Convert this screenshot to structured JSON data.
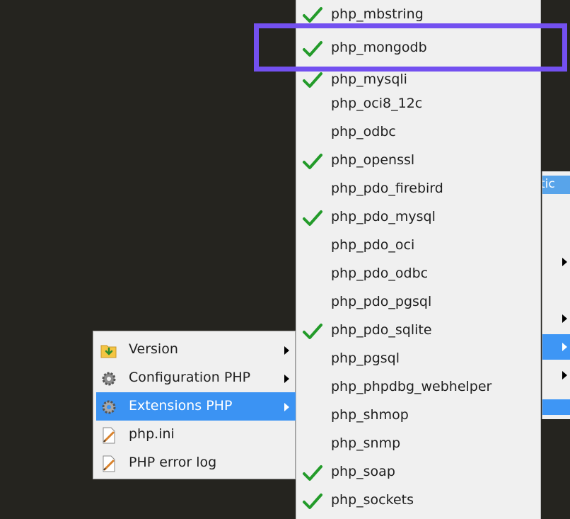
{
  "extensions_menu": {
    "items": [
      {
        "label": "php_mbstring",
        "checked": true
      },
      {
        "label": "php_mongodb",
        "checked": true
      },
      {
        "label": "php_mysqli",
        "checked": true
      },
      {
        "label": "php_oci8_12c",
        "checked": false
      },
      {
        "label": "php_odbc",
        "checked": false
      },
      {
        "label": "php_openssl",
        "checked": true
      },
      {
        "label": "php_pdo_firebird",
        "checked": false
      },
      {
        "label": "php_pdo_mysql",
        "checked": true
      },
      {
        "label": "php_pdo_oci",
        "checked": false
      },
      {
        "label": "php_pdo_odbc",
        "checked": false
      },
      {
        "label": "php_pdo_pgsql",
        "checked": false
      },
      {
        "label": "php_pdo_sqlite",
        "checked": true
      },
      {
        "label": "php_pgsql",
        "checked": false
      },
      {
        "label": "php_phpdbg_webhelper",
        "checked": false
      },
      {
        "label": "php_shmop",
        "checked": false
      },
      {
        "label": "php_snmp",
        "checked": false
      },
      {
        "label": "php_soap",
        "checked": true
      },
      {
        "label": "php_sockets",
        "checked": true
      }
    ]
  },
  "right_menu": {
    "header_text": "tic"
  },
  "wamp_menu": {
    "items": [
      {
        "label": "Version",
        "icon": "folder-icon",
        "has_submenu": true
      },
      {
        "label": "Configuration PHP",
        "icon": "gear-icon",
        "has_submenu": true
      },
      {
        "label": "Extensions PHP",
        "icon": "gear-icon",
        "has_submenu": true,
        "selected": true
      },
      {
        "label": "php.ini",
        "icon": "document-edit-icon",
        "has_submenu": false
      },
      {
        "label": "PHP error log",
        "icon": "document-edit-icon",
        "has_submenu": false
      }
    ]
  },
  "colors": {
    "highlight": "#7350f0",
    "selection": "#3b93f3",
    "check": "#239b2a",
    "menu_bg": "#f0f0f0",
    "desktop_bg": "#25241f"
  }
}
